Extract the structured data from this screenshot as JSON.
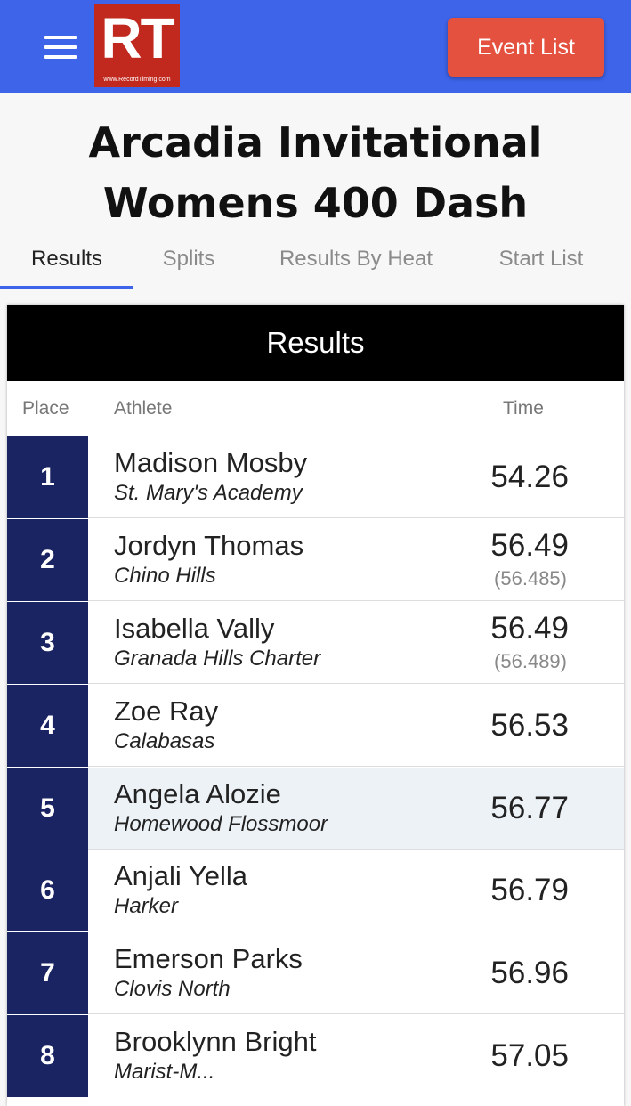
{
  "header": {
    "logo_letters": "RT",
    "logo_url": "www.RecordTiming.com",
    "event_list_label": "Event List"
  },
  "page": {
    "title_line1": "Arcadia Invitational",
    "title_line2": "Womens 400 Dash"
  },
  "tabs": [
    {
      "label": "Results",
      "active": true
    },
    {
      "label": "Splits",
      "active": false
    },
    {
      "label": "Results By Heat",
      "active": false
    },
    {
      "label": "Start List",
      "active": false
    }
  ],
  "results": {
    "heading": "Results",
    "columns": {
      "place": "Place",
      "athlete": "Athlete",
      "time": "Time"
    },
    "rows": [
      {
        "place": "1",
        "name": "Madison Mosby",
        "team": "St. Mary's Academy",
        "time": "54.26",
        "sub": ""
      },
      {
        "place": "2",
        "name": "Jordyn Thomas",
        "team": "Chino Hills",
        "time": "56.49",
        "sub": "(56.485)"
      },
      {
        "place": "3",
        "name": "Isabella Vally",
        "team": "Granada Hills Charter",
        "time": "56.49",
        "sub": "(56.489)"
      },
      {
        "place": "4",
        "name": "Zoe Ray",
        "team": "Calabasas",
        "time": "56.53",
        "sub": ""
      },
      {
        "place": "5",
        "name": "Angela Alozie",
        "team": "Homewood Flossmoor",
        "time": "56.77",
        "sub": "",
        "highlight": true
      },
      {
        "place": "6",
        "name": "Anjali Yella",
        "team": "Harker",
        "time": "56.79",
        "sub": ""
      },
      {
        "place": "7",
        "name": "Emerson Parks",
        "team": "Clovis North",
        "time": "56.96",
        "sub": ""
      },
      {
        "place": "8",
        "name": "Brooklynn Bright",
        "team": "Marist-M...",
        "time": "57.05",
        "sub": ""
      }
    ]
  },
  "colors": {
    "topbar": "#3e64ea",
    "logo": "#c1281e",
    "event_button": "#e4513f",
    "place_cell": "#1b2463"
  }
}
